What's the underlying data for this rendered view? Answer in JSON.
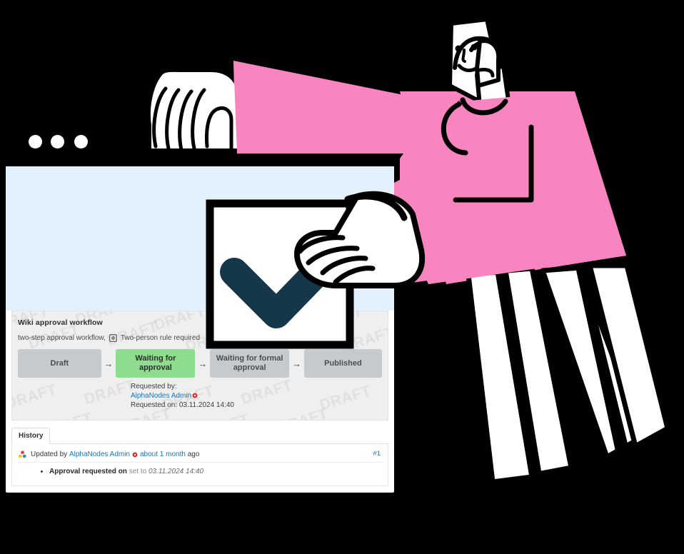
{
  "window": {
    "traffic_dots": [
      "dot-1",
      "dot-2",
      "dot-3"
    ],
    "minimize_bar": "window-minimize-bar"
  },
  "workflow": {
    "title": "Wiki approval workflow",
    "subtitle_prefix": "two-step approval workflow,",
    "two_person_icon": "two-person-rule-icon",
    "subtitle_suffix": "Two-person rule required",
    "steps": [
      {
        "label": "Draft",
        "state": "gray"
      },
      {
        "label": "Waiting for approval",
        "state": "green"
      },
      {
        "label": "Waiting for formal approval",
        "state": "gray"
      },
      {
        "label": "Published",
        "state": "gray"
      }
    ],
    "arrow_glyph": "→",
    "meta": {
      "requested_by_label": "Requested by:",
      "requested_by_user": "AlphaNodes Admin",
      "user_gear_icon": "red-gear-icon",
      "requested_on": "Requested on: 03.11.2024 14:40"
    },
    "watermark_text": "DRAFT",
    "colors": {
      "panel_bg": "#efefef",
      "step_gray": "#c6cacd",
      "step_green": "#8edd8f",
      "link": "#1f74b6",
      "hero_blue": "#e2f1fc"
    }
  },
  "history": {
    "tab_label": "History",
    "entry": {
      "group_icon": "user-group-icon",
      "prefix": "Updated by",
      "user": "AlphaNodes Admin",
      "user_gear_icon": "red-gear-icon",
      "time_link": "about 1 month",
      "time_suffix": "ago",
      "number": "#1"
    },
    "detail": {
      "field": "Approval requested on",
      "set_to": "set to",
      "value": "03.11.2024 14:40"
    }
  },
  "illustration": {
    "checkbox": "approval-checkmark-box",
    "check_color": "#14384a",
    "person_shirt_color": "#f985c0",
    "person": "person-illustration",
    "left_hand": "left-hand-illustration",
    "right_hand": "right-hand-illustration"
  }
}
